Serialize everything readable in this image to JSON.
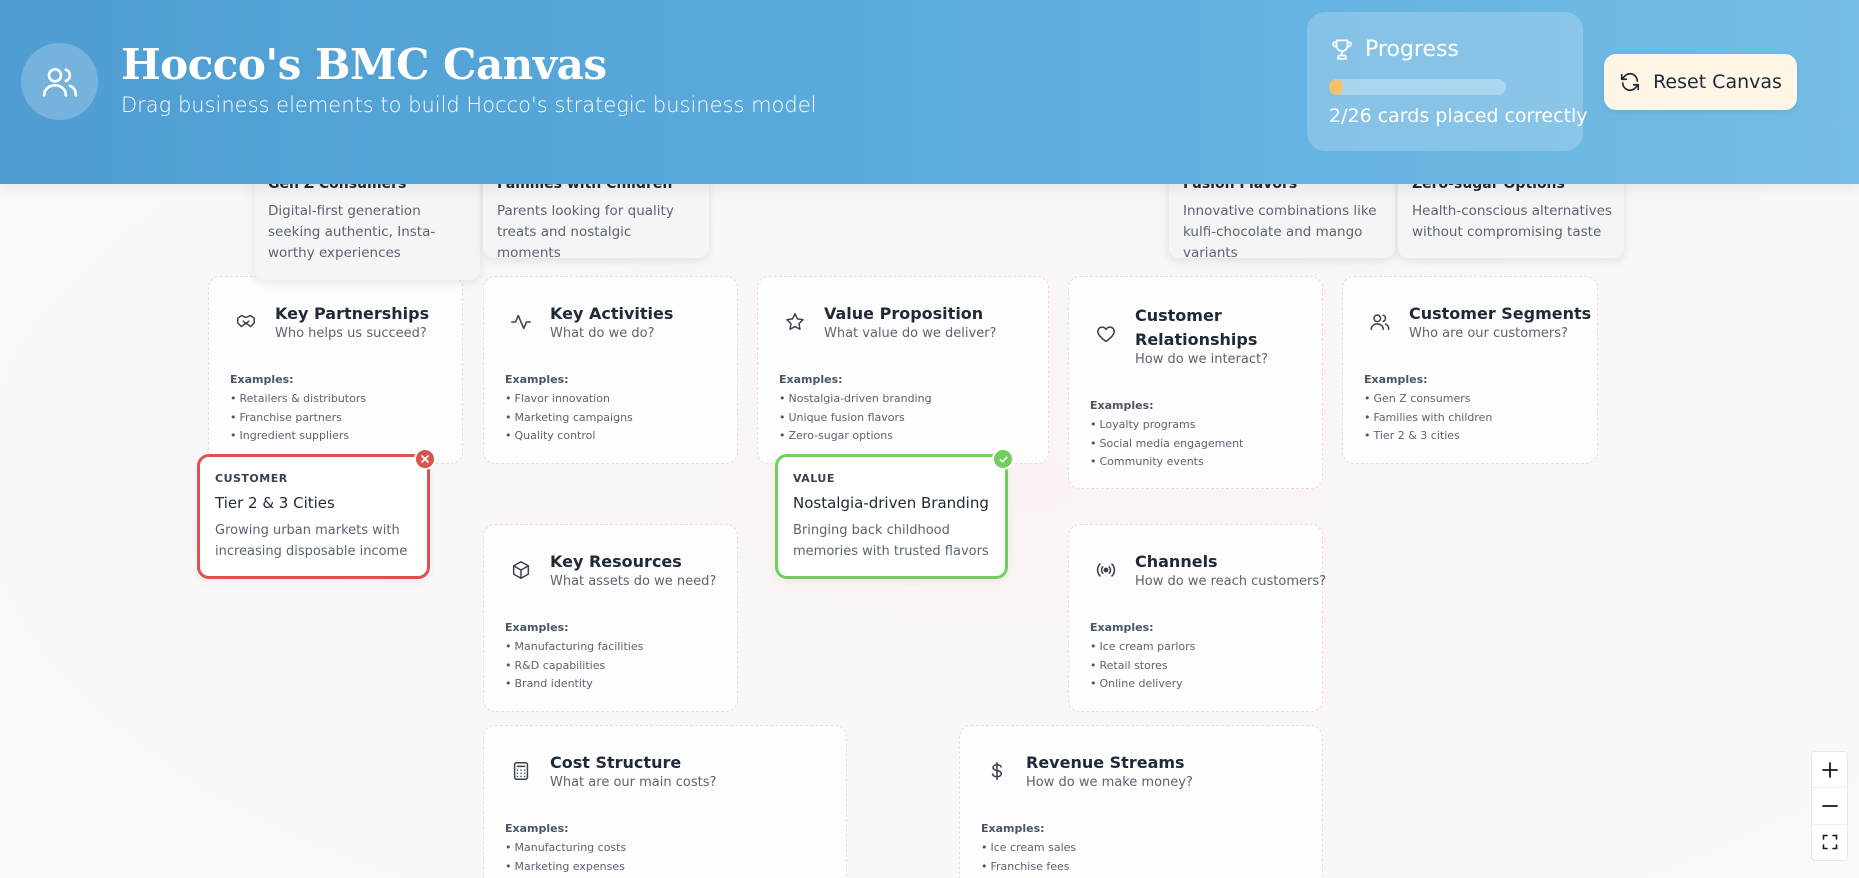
{
  "header": {
    "title": "Hocco's BMC Canvas",
    "subtitle": "Drag business elements to build Hocco's strategic business model",
    "avatar_icon": "users-icon",
    "progress": {
      "label": "Progress",
      "icon": "trophy-icon",
      "placed": 2,
      "total": 26,
      "text": "2/26 cards placed correctly",
      "fill_color": "#f2c16e"
    },
    "reset_label": "Reset Canvas",
    "reset_icon": "refresh-icon"
  },
  "pool": [
    {
      "title": "Gen Z Consumers",
      "desc": "Digital-first generation seeking authentic, Insta-worthy experiences"
    },
    {
      "title": "Families with Children",
      "desc": "Parents looking for quality treats and nostalgic moments"
    },
    {
      "title": "Fusion Flavors",
      "desc": "Innovative combinations like kulfi-chocolate and mango variants"
    },
    {
      "title": "Zero-sugar Options",
      "desc": "Health-conscious alternatives without compromising taste"
    }
  ],
  "examples_label": "Examples:",
  "blocks": {
    "key_partnerships": {
      "title": "Key Partnerships",
      "subtitle": "Who helps us succeed?",
      "icon": "handshake-icon",
      "examples": [
        "Retailers & distributors",
        "Franchise partners",
        "Ingredient suppliers"
      ]
    },
    "key_activities": {
      "title": "Key Activities",
      "subtitle": "What do we do?",
      "icon": "activity-icon",
      "examples": [
        "Flavor innovation",
        "Marketing campaigns",
        "Quality control"
      ]
    },
    "value_proposition": {
      "title": "Value Proposition",
      "subtitle": "What value do we deliver?",
      "icon": "star-icon",
      "examples": [
        "Nostalgia-driven branding",
        "Unique fusion flavors",
        "Zero-sugar options"
      ]
    },
    "customer_relationships": {
      "title": "Customer Relationships",
      "title_line1": "Customer",
      "title_line2": "Relationships",
      "subtitle": "How do we interact?",
      "icon": "heart-icon",
      "examples": [
        "Loyalty programs",
        "Social media engagement",
        "Community events"
      ]
    },
    "customer_segments": {
      "title": "Customer Segments",
      "subtitle": "Who are our customers?",
      "icon": "users-icon",
      "examples": [
        "Gen Z consumers",
        "Families with children",
        "Tier 2 & 3 cities"
      ]
    },
    "key_resources": {
      "title": "Key Resources",
      "subtitle": "What assets do we need?",
      "icon": "box-icon",
      "examples": [
        "Manufacturing facilities",
        "R&D capabilities",
        "Brand identity"
      ]
    },
    "channels": {
      "title": "Channels",
      "subtitle": "How do we reach customers?",
      "icon": "broadcast-icon",
      "examples": [
        "Ice cream parlors",
        "Retail stores",
        "Online delivery"
      ]
    },
    "cost_structure": {
      "title": "Cost Structure",
      "subtitle": "What are our main costs?",
      "icon": "calculator-icon",
      "examples": [
        "Manufacturing costs",
        "Marketing expenses"
      ]
    },
    "revenue_streams": {
      "title": "Revenue Streams",
      "subtitle": "How do we make money?",
      "icon": "dollar-icon",
      "examples": [
        "Ice cream sales",
        "Franchise fees"
      ]
    }
  },
  "placed_cards": [
    {
      "category": "CUSTOMER",
      "title": "Tier 2 & 3 Cities",
      "desc": "Growing urban markets with increasing disposable income",
      "status": "incorrect",
      "status_color": "#d9534f"
    },
    {
      "category": "VALUE",
      "title": "Nostalgia-driven Branding",
      "desc": "Bringing back childhood memories with trusted flavors",
      "status": "correct",
      "status_color": "#6fcf5f"
    }
  ],
  "zoom": {
    "zoom_in_icon": "plus-icon",
    "zoom_out_icon": "minus-icon",
    "fit_icon": "fullscreen-icon"
  }
}
